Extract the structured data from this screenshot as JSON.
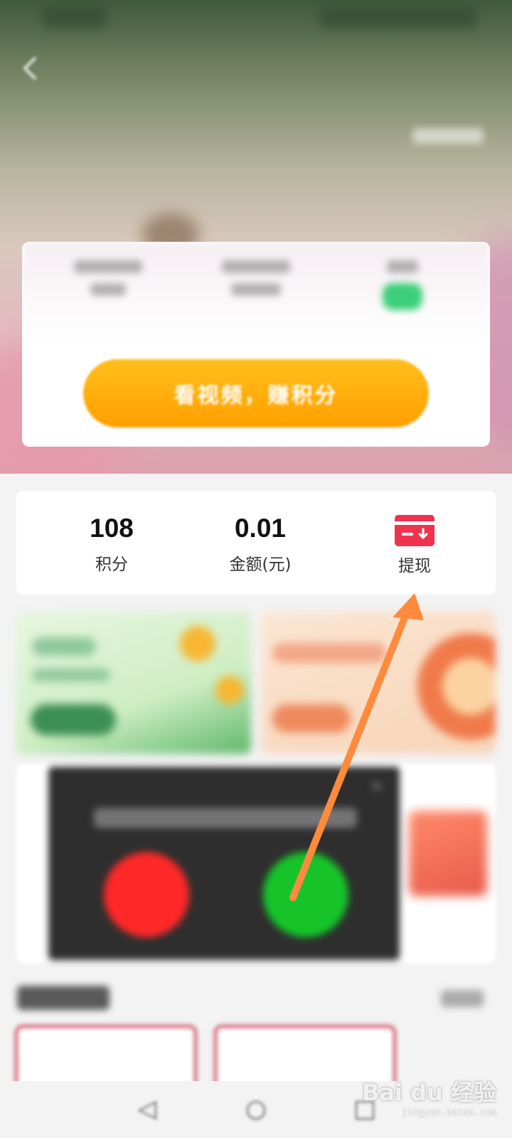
{
  "watch_button": {
    "label": "看视频，赚积分"
  },
  "balance": {
    "points": {
      "value": "108",
      "label": "积分"
    },
    "amount": {
      "value": "0.01",
      "label": "金额(元)"
    },
    "withdraw": {
      "label": "提现",
      "icon": "card-withdraw-icon"
    }
  },
  "colors": {
    "accent_orange": "#ff9f00",
    "withdraw_red": "#f0334d",
    "annotation_arrow": "#ff8a3d"
  },
  "watermark": {
    "logo": "Bai du 经验",
    "sub": "jingyan.baidu.com"
  }
}
